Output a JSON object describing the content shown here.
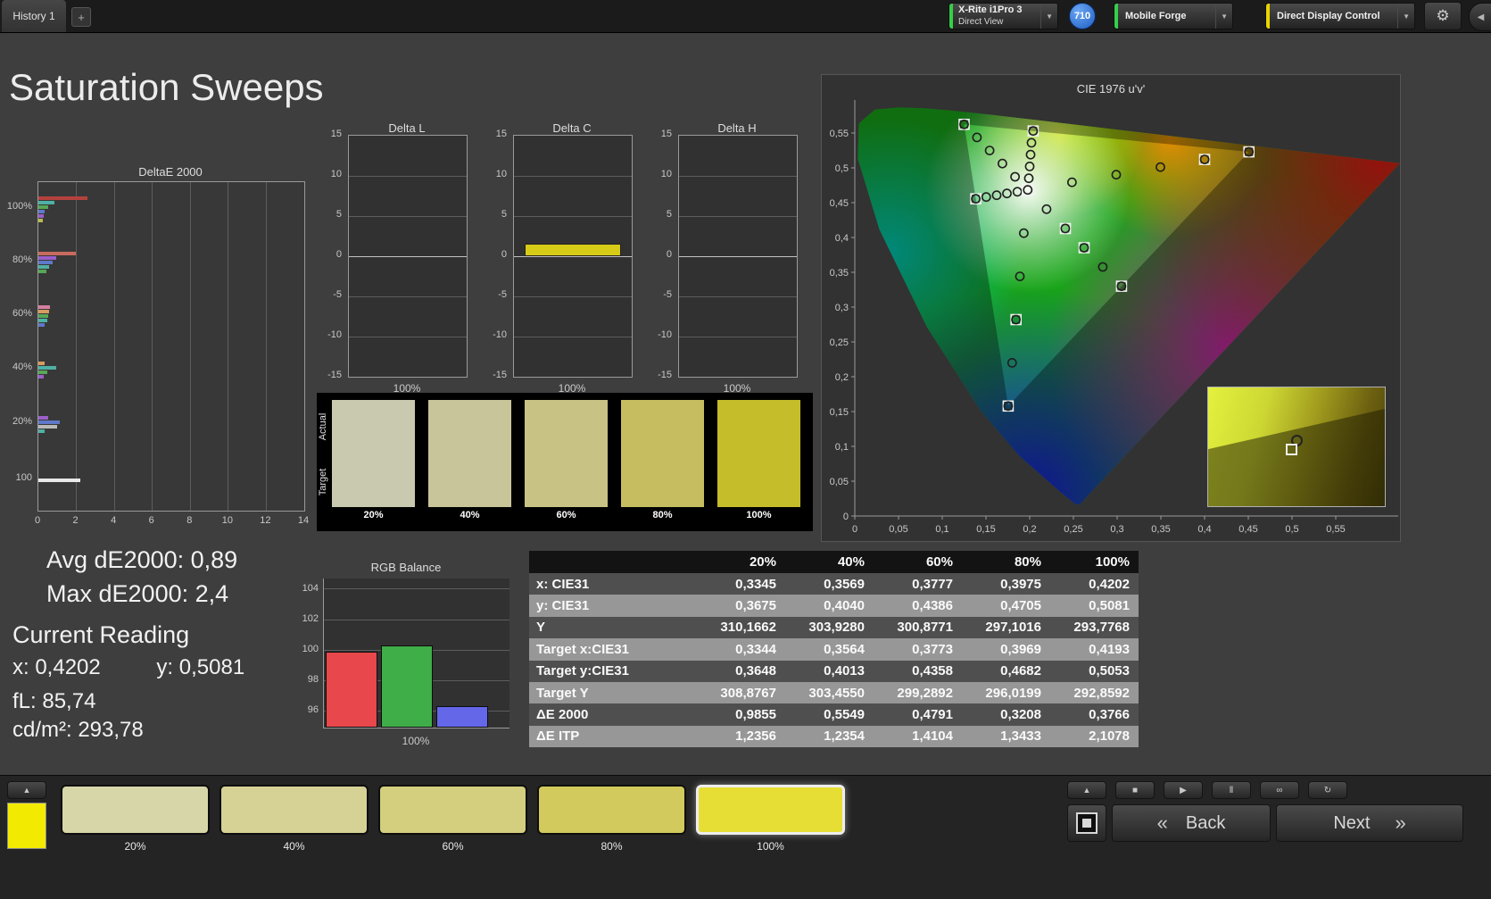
{
  "topbar": {
    "history_tab": "History 1",
    "add_tab_label": "+",
    "chevron_glyph": "▼",
    "meter": {
      "line1": "X-Rite i1Pro 3",
      "line2": "Direct View",
      "accent": "#35cf49"
    },
    "badge_value": "710",
    "source": {
      "label": "Mobile Forge",
      "accent": "#35cf49"
    },
    "display_control": {
      "label": "Direct Display Control",
      "accent": "#e8d500"
    },
    "gear_glyph": "⚙",
    "collapse_glyph": "◀"
  },
  "page_title": "Saturation Sweeps",
  "stats": {
    "avg_de": "Avg dE2000: 0,89",
    "max_de": "Max dE2000: 2,4",
    "current_reading_title": "Current Reading",
    "x_reading": "x: 0,4202",
    "y_reading": "y: 0,5081",
    "fl_reading": "fL: 85,74",
    "cdm2_reading": "cd/m²: 293,78"
  },
  "chart_data": [
    {
      "id": "deltae2000",
      "type": "bar",
      "orientation": "horizontal",
      "title": "DeltaE 2000",
      "xlim": [
        0,
        14
      ],
      "xticks": [
        0,
        2,
        4,
        6,
        8,
        10,
        12,
        14
      ],
      "categories": [
        "100%",
        "80%",
        "60%",
        "40%",
        "20%",
        "100"
      ],
      "groups": [
        {
          "label": "100%",
          "bars": [
            {
              "color": "#b5413d",
              "value": 2.6
            },
            {
              "color": "#4fb0a5",
              "value": 0.85
            },
            {
              "color": "#57a757",
              "value": 0.5
            },
            {
              "color": "#5f78c9",
              "value": 0.35
            },
            {
              "color": "#9a5fc9",
              "value": 0.3
            },
            {
              "color": "#b9b94f",
              "value": 0.25
            }
          ]
        },
        {
          "label": "80%",
          "bars": [
            {
              "color": "#c96a5f",
              "value": 1.95
            },
            {
              "color": "#9a5fc9",
              "value": 0.95
            },
            {
              "color": "#5f78c9",
              "value": 0.75
            },
            {
              "color": "#4fb0a5",
              "value": 0.55
            },
            {
              "color": "#57a757",
              "value": 0.4
            }
          ]
        },
        {
          "label": "60%",
          "bars": [
            {
              "color": "#d77fa0",
              "value": 0.6
            },
            {
              "color": "#d79b5f",
              "value": 0.55
            },
            {
              "color": "#57a757",
              "value": 0.5
            },
            {
              "color": "#4fb0a5",
              "value": 0.45
            },
            {
              "color": "#5f78c9",
              "value": 0.35
            }
          ]
        },
        {
          "label": "40%",
          "bars": [
            {
              "color": "#d79b5f",
              "value": 0.35
            },
            {
              "color": "#4fb0a5",
              "value": 0.95
            },
            {
              "color": "#57a757",
              "value": 0.45
            },
            {
              "color": "#9a5fc9",
              "value": 0.3
            }
          ]
        },
        {
          "label": "20%",
          "bars": [
            {
              "color": "#9a5fc9",
              "value": 0.5
            },
            {
              "color": "#5f78c9",
              "value": 1.15
            },
            {
              "color": "#b9b9b9",
              "value": 1.0
            },
            {
              "color": "#4fb0a5",
              "value": 0.35
            }
          ]
        },
        {
          "label": "100",
          "bars": [
            {
              "color": "#e8e8e8",
              "value": 2.2
            }
          ]
        }
      ]
    },
    {
      "id": "delta-l",
      "type": "bar",
      "title": "Delta L",
      "ylim": [
        -15,
        15
      ],
      "yticks": [
        15,
        10,
        5,
        0,
        -5,
        -10,
        -15
      ],
      "categories": [
        "100%"
      ],
      "values": [
        0
      ],
      "bar_color": "#d6cb17"
    },
    {
      "id": "delta-c",
      "type": "bar",
      "title": "Delta C",
      "ylim": [
        -15,
        15
      ],
      "yticks": [
        15,
        10,
        5,
        0,
        -5,
        -10,
        -15
      ],
      "categories": [
        "100%"
      ],
      "values": [
        1.6
      ],
      "bar_color": "#d6cb17"
    },
    {
      "id": "delta-h",
      "type": "bar",
      "title": "Delta H",
      "ylim": [
        -15,
        15
      ],
      "yticks": [
        15,
        10,
        5,
        0,
        -5,
        -10,
        -15
      ],
      "categories": [
        "100%"
      ],
      "values": [
        0
      ],
      "bar_color": "#d6cb17"
    },
    {
      "id": "rgb-balance",
      "type": "bar",
      "title": "RGB Balance",
      "categories": [
        "Red",
        "Green",
        "Blue"
      ],
      "values": [
        99.9,
        100.3,
        96.3
      ],
      "colors": [
        "#e8474b",
        "#3fae49",
        "#6467e8"
      ],
      "ylim": [
        94.9,
        104.7
      ],
      "yticks": [
        104,
        102,
        100,
        98,
        96
      ],
      "xlabel": "100%"
    },
    {
      "id": "cie1976",
      "type": "scatter",
      "title": "CIE 1976 u'v'",
      "xlim": [
        0,
        0.58
      ],
      "ylim": [
        0,
        0.59
      ],
      "tick_step": 0.05,
      "xtick_labels": [
        "0",
        "0,05",
        "0,1",
        "0,15",
        "0,2",
        "0,25",
        "0,3",
        "0,35",
        "0,4",
        "0,45",
        "0,5",
        "0,55"
      ],
      "ytick_labels": [
        "0",
        "0,05",
        "0,1",
        "0,15",
        "0,2",
        "0,25",
        "0,3",
        "0,35",
        "0,4",
        "0,45",
        "0,5",
        "0,55"
      ],
      "white_point": [
        0.1978,
        0.4683
      ],
      "gamut_triangle": [
        [
          0.4507,
          0.5229
        ],
        [
          0.125,
          0.5625
        ],
        [
          0.1754,
          0.1579
        ]
      ],
      "targets": [
        [
          0.125,
          0.5625
        ],
        [
          0.4507,
          0.5229
        ],
        [
          0.4,
          0.512
        ],
        [
          0.305,
          0.33
        ],
        [
          0.1754,
          0.1579
        ],
        [
          0.1844,
          0.2821
        ],
        [
          0.1384,
          0.4555
        ],
        [
          0.2408,
          0.4128
        ],
        [
          0.2622,
          0.3852
        ],
        [
          0.204,
          0.553
        ]
      ],
      "measurements": [
        [
          0.199,
          0.485
        ],
        [
          0.2,
          0.502
        ],
        [
          0.201,
          0.519
        ],
        [
          0.202,
          0.536
        ],
        [
          0.204,
          0.553
        ],
        [
          0.1833,
          0.4872
        ],
        [
          0.1688,
          0.5061
        ],
        [
          0.1542,
          0.5249
        ],
        [
          0.1397,
          0.5437
        ],
        [
          0.125,
          0.5625
        ],
        [
          0.2484,
          0.4792
        ],
        [
          0.299,
          0.4901
        ],
        [
          0.3495,
          0.501
        ],
        [
          0.4001,
          0.512
        ],
        [
          0.4507,
          0.5229
        ],
        [
          0.1859,
          0.4657
        ],
        [
          0.174,
          0.4632
        ],
        [
          0.1622,
          0.4606
        ],
        [
          0.1503,
          0.4581
        ],
        [
          0.1384,
          0.4555
        ],
        [
          0.2193,
          0.4406
        ],
        [
          0.2407,
          0.413
        ],
        [
          0.2622,
          0.3853
        ],
        [
          0.2836,
          0.3577
        ],
        [
          0.305,
          0.33
        ],
        [
          0.1933,
          0.4062
        ],
        [
          0.1888,
          0.3441
        ],
        [
          0.1843,
          0.282
        ],
        [
          0.1799,
          0.22
        ],
        [
          0.1754,
          0.1579
        ]
      ]
    }
  ],
  "patch_panel": {
    "row_labels": [
      "Actual",
      "Target"
    ],
    "swatches": [
      {
        "label": "20%",
        "color": "#c9c9b0"
      },
      {
        "label": "40%",
        "color": "#c9c59a"
      },
      {
        "label": "60%",
        "color": "#c8c384"
      },
      {
        "label": "80%",
        "color": "#c5bd60"
      },
      {
        "label": "100%",
        "color": "#c6bd2a"
      }
    ]
  },
  "results_table": {
    "column_headers": [
      "20%",
      "40%",
      "60%",
      "80%",
      "100%"
    ],
    "rows": [
      {
        "label": "x: CIE31",
        "values": [
          "0,3345",
          "0,3569",
          "0,3777",
          "0,3975",
          "0,4202"
        ]
      },
      {
        "label": "y: CIE31",
        "values": [
          "0,3675",
          "0,4040",
          "0,4386",
          "0,4705",
          "0,5081"
        ]
      },
      {
        "label": "Y",
        "values": [
          "310,1662",
          "303,9280",
          "300,8771",
          "297,1016",
          "293,7768"
        ]
      },
      {
        "label": "Target x:CIE31",
        "values": [
          "0,3344",
          "0,3564",
          "0,3773",
          "0,3969",
          "0,4193"
        ]
      },
      {
        "label": "Target y:CIE31",
        "values": [
          "0,3648",
          "0,4013",
          "0,4358",
          "0,4682",
          "0,5053"
        ]
      },
      {
        "label": "Target Y",
        "values": [
          "308,8767",
          "303,4550",
          "299,2892",
          "296,0199",
          "292,8592"
        ]
      },
      {
        "label": "ΔE 2000",
        "values": [
          "0,9855",
          "0,5549",
          "0,4791",
          "0,3208",
          "0,3766"
        ]
      },
      {
        "label": "ΔE ITP",
        "values": [
          "1,2356",
          "1,2354",
          "1,4104",
          "1,3433",
          "2,1078"
        ]
      }
    ]
  },
  "bottom_bar": {
    "current_chip_color": "#f2ea00",
    "up_glyph": "▲",
    "patch_buttons": [
      {
        "label": "20%",
        "color": "#d6d6a8"
      },
      {
        "label": "40%",
        "color": "#d6d295"
      },
      {
        "label": "60%",
        "color": "#d4cf7e"
      },
      {
        "label": "80%",
        "color": "#d2ca5c"
      },
      {
        "label": "100%",
        "color": "#e6de35"
      }
    ],
    "selected_patch_index": 4,
    "transport": [
      {
        "name": "stop",
        "glyph": "■"
      },
      {
        "name": "play",
        "glyph": "▶"
      },
      {
        "name": "pause",
        "glyph": "Ⅱ"
      },
      {
        "name": "continuous",
        "glyph": "∞"
      },
      {
        "name": "repeat",
        "glyph": "↻"
      }
    ],
    "back_label": "Back",
    "back_chevron": "«",
    "next_label": "Next",
    "next_chevron": "»"
  }
}
